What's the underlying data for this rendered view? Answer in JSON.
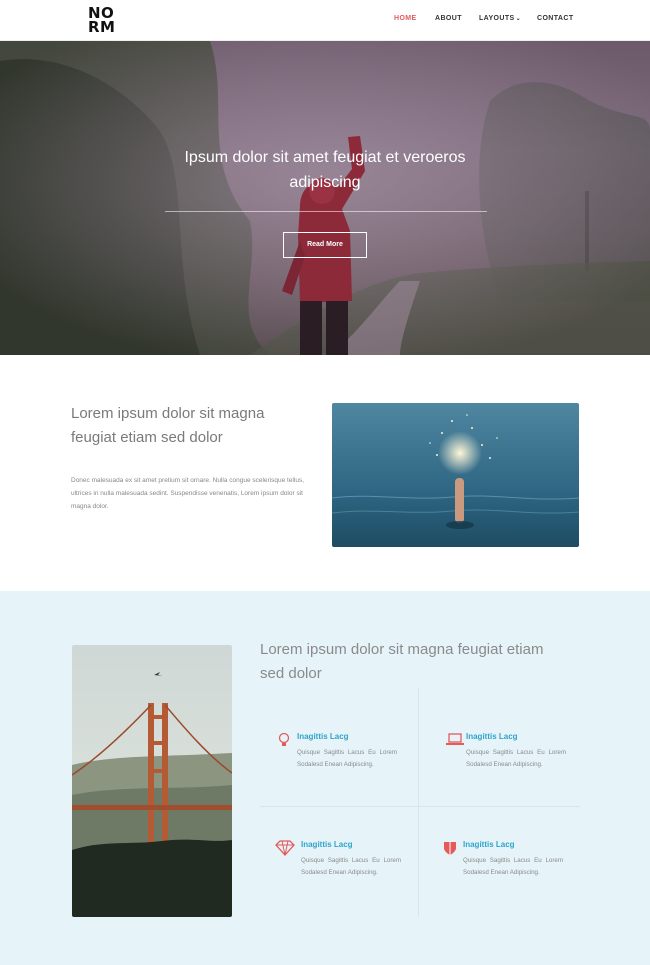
{
  "brand": {
    "logo_line1": "NO",
    "logo_line2": "RM"
  },
  "nav": {
    "items": [
      {
        "label": "HOME",
        "active": true
      },
      {
        "label": "ABOUT"
      },
      {
        "label": "LAYOUTS"
      },
      {
        "label": "CONTACT"
      }
    ]
  },
  "hero": {
    "title": "Ipsum dolor sit amet feugiat et veroeros adipiscing",
    "button_label": "Read More"
  },
  "intro": {
    "heading": "Lorem ipsum dolor sit magna feugiat etiam sed dolor",
    "body": "Donec malesuada ex sit amet pretium sit ornare. Nulla congue scelerisque tellus, ultrices in nulla malesuada sedint. Suspendisse venenatis, Lorem ipsum dolor sit magna dolor."
  },
  "features_section": {
    "heading": "Lorem ipsum dolor sit magna feugiat etiam sed dolor",
    "features": [
      {
        "icon": "lightbulb-icon",
        "title": "Inagittis Lacg",
        "text": "Quisque Sagittis Lacus Eu Lorem Sodalesd Enean Adipiscing."
      },
      {
        "icon": "laptop-icon",
        "title": "Inagittis Lacg",
        "text": "Quisque Sagittis Lacus Eu Lorem Sodalesd Enean Adipiscing."
      },
      {
        "icon": "diamond-icon",
        "title": "Inagittis Lacg",
        "text": "Quisque Sagittis Lacus Eu Lorem Sodalesd Enean Adipiscing."
      },
      {
        "icon": "shield-icon",
        "title": "Inagittis Lacg",
        "text": "Quisque Sagittis Lacus Eu Lorem Sodalesd Enean Adipiscing."
      }
    ]
  },
  "colors": {
    "accent": "#e55a5a",
    "link_blue": "#2fa4c9",
    "section_bg": "#e6f4fa"
  }
}
